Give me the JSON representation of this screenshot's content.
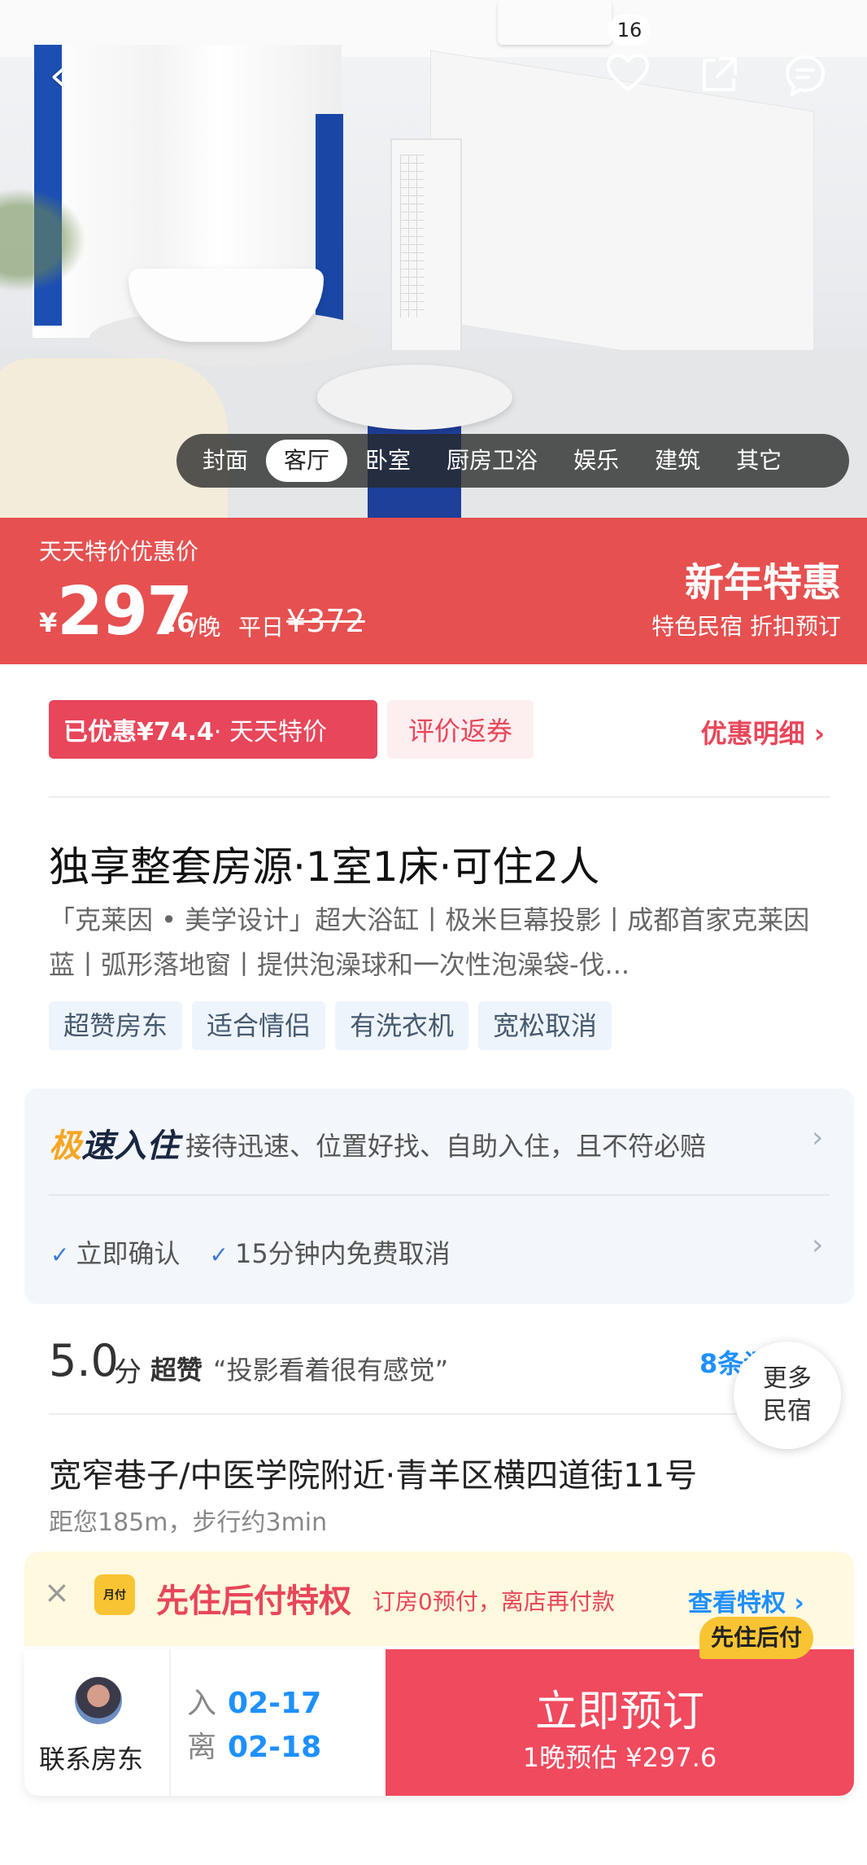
{
  "header": {
    "favorite_count": "16"
  },
  "gallery_tabs": [
    "封面",
    "客厅",
    "卧室",
    "厨房卫浴",
    "娱乐",
    "建筑",
    "其它"
  ],
  "gallery_active_index": 1,
  "price": {
    "promo_label": "天天特价优惠价",
    "currency": "¥",
    "integer": "297",
    "decimal": ".6",
    "unit": "/晚",
    "weekday_label": "平日",
    "original": "¥372",
    "campaign_title": "新年特惠",
    "campaign_sub": "特色民宿 折扣预订"
  },
  "discount": {
    "saved": "已优惠¥74.4",
    "saved_type": "· 天天特价",
    "coupon": "评价返券",
    "detail_link": "优惠明细"
  },
  "listing": {
    "title": "独享整套房源·1室1床·可住2人",
    "description": "「克莱因 • 美学设计」超大浴缸丨极米巨幕投影丨成都首家克莱因蓝丨弧形落地窗丨提供泡澡球和一次性泡澡袋-伐...",
    "tags": [
      "超赞房东",
      "适合情侣",
      "有洗衣机",
      "宽松取消"
    ]
  },
  "fast_checkin": {
    "logo_a": "极",
    "logo_b": "速入住",
    "text": "接待迅速、位置好找、自助入住，且不符必赔",
    "confirm": "立即确认",
    "cancel": "15分钟内免费取消"
  },
  "rating": {
    "score": "5.0",
    "unit": "分",
    "level": "超赞",
    "quote": "“投影看着很有感觉”",
    "count": "8条评",
    "more_button": "更多民宿"
  },
  "location": {
    "address": "宽窄巷子/中医学院附近·青羊区横四道街11号",
    "distance": "距您185m，步行约3min"
  },
  "pay_later": {
    "icon_text": "月付",
    "title": "先住后付特权",
    "subtitle": "订房0预付，离店再付款",
    "link": "查看特权"
  },
  "bottom": {
    "contact": "联系房东",
    "checkin_label": "入",
    "checkin_date": "02-17",
    "checkout_label": "离",
    "checkout_date": "02-18",
    "book_title": "立即预订",
    "book_sub": "1晚预估 ¥297.6",
    "book_badge": "先住后付"
  },
  "colors": {
    "brand_red": "#e65050",
    "accent_pink": "#f04a5e",
    "link_blue": "#1e90ff",
    "paylater_yellow": "#f9c433"
  }
}
